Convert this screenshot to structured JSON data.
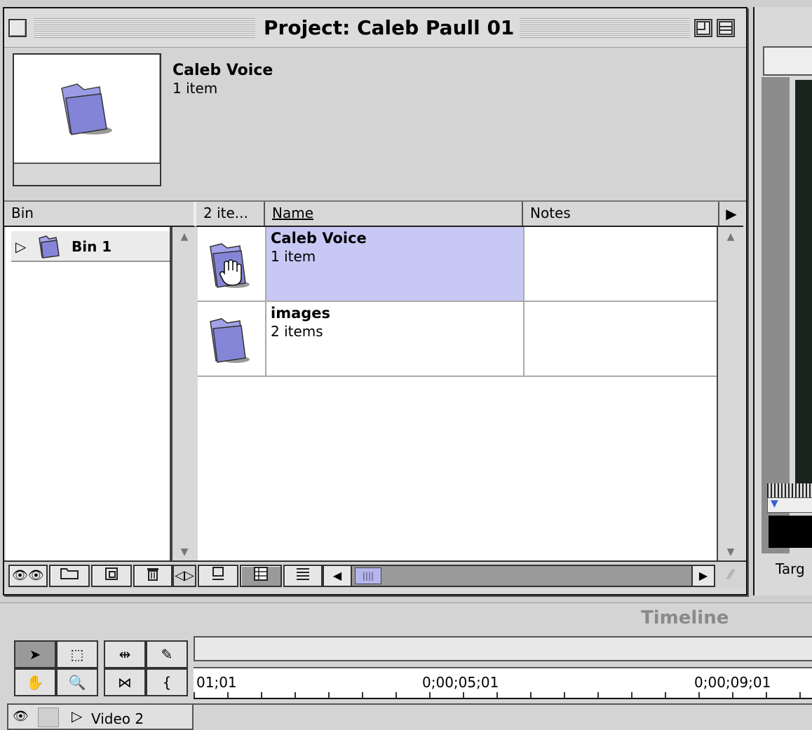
{
  "window": {
    "title": "Project: Caleb Paull 01"
  },
  "preview": {
    "item_name": "Caleb Voice",
    "item_count": "1 item"
  },
  "bin_panel": {
    "header": "Bin",
    "items": [
      {
        "label": "Bin 1"
      }
    ]
  },
  "table": {
    "columns": {
      "count": "2 ite...",
      "name": "Name",
      "notes": "Notes"
    },
    "rows": [
      {
        "name": "Caleb Voice",
        "count": "1 item",
        "notes": "",
        "selected": true
      },
      {
        "name": "images",
        "count": "2 items",
        "notes": "",
        "selected": false
      }
    ]
  },
  "toolbar": {
    "find_icon": "binoculars-icon",
    "new_bin_icon": "folder-icon",
    "new_item_icon": "new-item-icon",
    "delete_icon": "trash-icon",
    "views": [
      "icon-view",
      "thumbnail-view",
      "list-view"
    ]
  },
  "monitor": {
    "target_label": "Targ"
  },
  "timeline": {
    "title": "Timeline",
    "timecodes": [
      "01;01",
      "0;00;05;01",
      "0;00;09;01"
    ],
    "track": "Video 2"
  },
  "colors": {
    "selection": "#c8c8f4",
    "folder": "#8f8fe0"
  }
}
